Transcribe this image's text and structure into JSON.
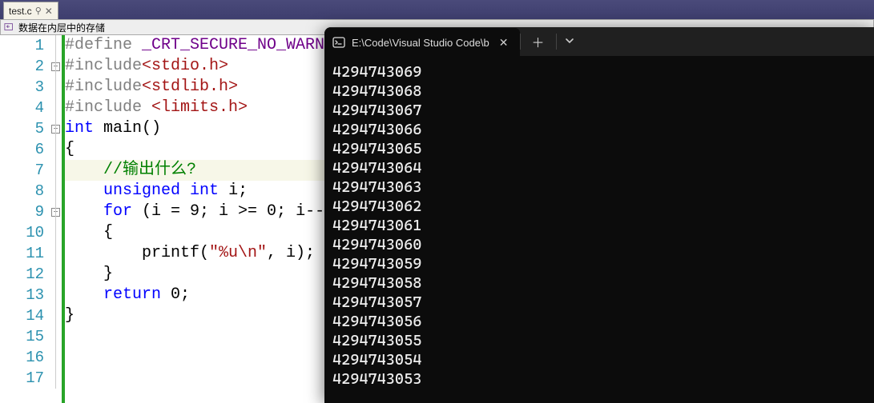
{
  "editor": {
    "tab_filename": "test.c",
    "breadcrumb": "数据在内层中的存储",
    "current_line": 7,
    "lines": [
      {
        "num": 1,
        "fold": "",
        "html": "<span class='tok-pp'>#define </span><span class='tok-mac'>_CRT_SECURE_NO_WARN</span>"
      },
      {
        "num": 2,
        "fold": "box",
        "html": "<span class='tok-pp'>#include</span><span class='tok-str'>&lt;stdio.h&gt;</span>"
      },
      {
        "num": 3,
        "fold": "",
        "html": "<span class='tok-pp'>#include</span><span class='tok-str'>&lt;stdlib.h&gt;</span>"
      },
      {
        "num": 4,
        "fold": "",
        "html": "<span class='tok-pp'>#include </span><span class='tok-str'>&lt;limits.h&gt;</span>"
      },
      {
        "num": 5,
        "fold": "box",
        "html": "<span class='tok-kw'>int</span><span class='tok-txt'> main()</span>"
      },
      {
        "num": 6,
        "fold": "",
        "html": "<span class='tok-txt'>{</span>"
      },
      {
        "num": 7,
        "fold": "",
        "html": "    <span class='tok-cmt'>//输出什么?</span>"
      },
      {
        "num": 8,
        "fold": "",
        "html": "    <span class='tok-kw'>unsigned</span> <span class='tok-kw'>int</span><span class='tok-txt'> i;</span>"
      },
      {
        "num": 9,
        "fold": "box",
        "html": "    <span class='tok-kw'>for</span><span class='tok-txt'> (i = 9; i &gt;= 0; i--</span>"
      },
      {
        "num": 10,
        "fold": "",
        "html": "    <span class='tok-txt'>{</span>"
      },
      {
        "num": 11,
        "fold": "",
        "html": "        <span class='tok-txt'>printf(</span><span class='tok-str'>\"%u\\n\"</span><span class='tok-txt'>, i);</span>"
      },
      {
        "num": 12,
        "fold": "",
        "html": "    <span class='tok-txt'>}</span>"
      },
      {
        "num": 13,
        "fold": "",
        "html": "    <span class='tok-kw'>return</span><span class='tok-txt'> 0;</span>"
      },
      {
        "num": 14,
        "fold": "",
        "html": "<span class='tok-txt'>}</span>"
      },
      {
        "num": 15,
        "fold": "",
        "html": ""
      },
      {
        "num": 16,
        "fold": "",
        "html": ""
      },
      {
        "num": 17,
        "fold": "",
        "html": ""
      }
    ]
  },
  "terminal": {
    "tab_title": "E:\\Code\\Visual Studio Code\\b",
    "output": [
      "4294743069",
      "4294743068",
      "4294743067",
      "4294743066",
      "4294743065",
      "4294743064",
      "4294743063",
      "4294743062",
      "4294743061",
      "4294743060",
      "4294743059",
      "4294743058",
      "4294743057",
      "4294743056",
      "4294743055",
      "4294743054",
      "4294743053"
    ]
  }
}
